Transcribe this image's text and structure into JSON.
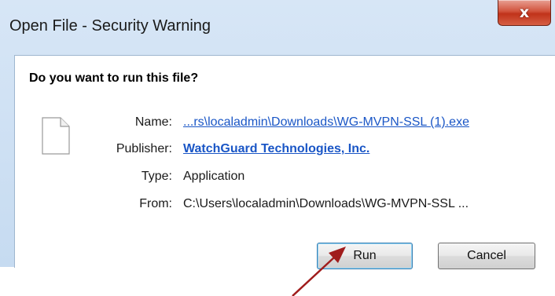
{
  "window": {
    "title": "Open File - Security Warning",
    "close_glyph": "x"
  },
  "dialog": {
    "question": "Do you want to run this file?",
    "file_icon": "generic-file-icon",
    "fields": {
      "name_label": "Name:",
      "name_value": "...rs\\localadmin\\Downloads\\WG-MVPN-SSL (1).exe",
      "publisher_label": "Publisher:",
      "publisher_value": "WatchGuard Technologies, Inc.",
      "type_label": "Type:",
      "type_value": "Application",
      "from_label": "From:",
      "from_value": "C:\\Users\\localadmin\\Downloads\\WG-MVPN-SSL ..."
    },
    "buttons": {
      "run": "Run",
      "cancel": "Cancel"
    }
  },
  "annotation": {
    "arrow_color": "#a01c1c"
  },
  "colors": {
    "link": "#1a56c6",
    "close_button": "#c0321a"
  }
}
